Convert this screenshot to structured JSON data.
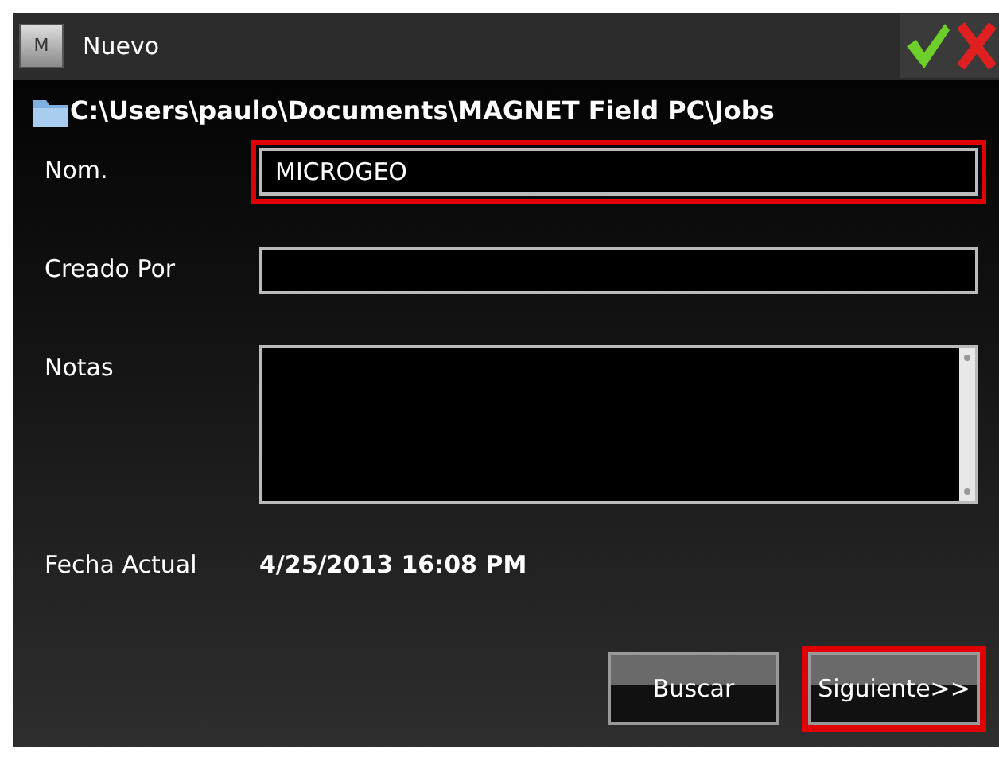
{
  "window": {
    "title": "Nuevo",
    "logo": "M"
  },
  "path": "C:\\Users\\paulo\\Documents\\MAGNET Field PC\\Jobs",
  "fields": [
    {
      "kind": "input",
      "label": "Nom.",
      "value": "MICROGEO",
      "highlighted": true
    },
    {
      "kind": "input",
      "label": "Creado Por",
      "highlighted": false
    },
    {
      "kind": "textarea",
      "label": "Notas",
      "highlighted": false
    }
  ],
  "date": {
    "label": "Fecha Actual",
    "value": "4/25/2013 16:08 PM"
  },
  "buttons": [
    {
      "label": "Buscar",
      "highlighted": false
    },
    {
      "label": "Siguiente>>",
      "highlighted": true
    }
  ]
}
